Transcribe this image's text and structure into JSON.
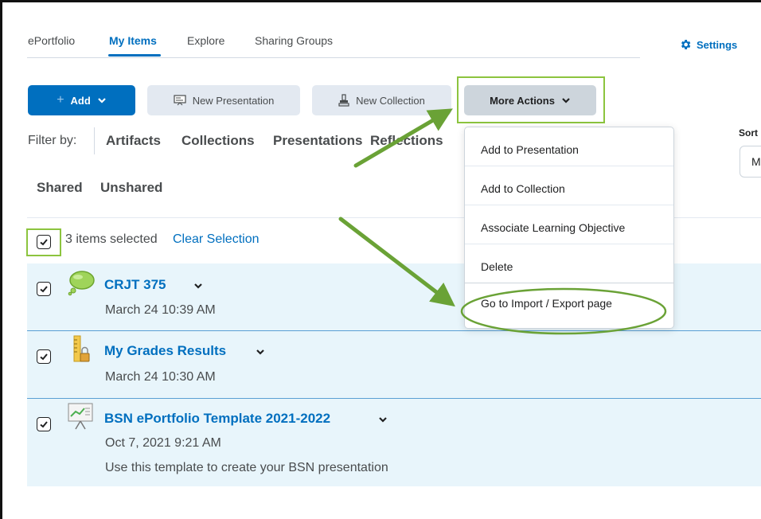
{
  "tabs": [
    "ePortfolio",
    "My Items",
    "Explore",
    "Sharing Groups"
  ],
  "settings_label": "Settings",
  "toolbar": {
    "add_label": "Add",
    "new_presentation_label": "New Presentation",
    "new_collection_label": "New Collection",
    "more_actions_label": "More Actions"
  },
  "filter": {
    "label": "Filter by:",
    "options": [
      "Artifacts",
      "Collections",
      "Presentations",
      "Reflections"
    ],
    "share_options": [
      "Shared",
      "Unshared"
    ]
  },
  "sort": {
    "label": "Sort",
    "value": "M"
  },
  "selection": {
    "count_text": "3 items selected",
    "clear_label": "Clear Selection"
  },
  "menu": {
    "items": [
      "Add to Presentation",
      "Add to Collection",
      "Associate Learning Objective",
      "Delete",
      "Go to Import / Export page"
    ]
  },
  "items": [
    {
      "title": "CRJT 375",
      "date": "March 24 10:39 AM",
      "description": "",
      "icon": "reflection-icon"
    },
    {
      "title": "My Grades Results",
      "date": "March 24 10:30 AM",
      "description": "",
      "icon": "ruler-lock-icon"
    },
    {
      "title": "BSN ePortfolio Template 2021-2022",
      "date": "Oct 7, 2021 9:21 AM",
      "description": "Use this template to create your BSN presentation",
      "icon": "presentation-icon"
    }
  ],
  "colors": {
    "primary": "#006fbf",
    "highlight": "#8cc43e",
    "row_bg": "#e8f5fb"
  }
}
